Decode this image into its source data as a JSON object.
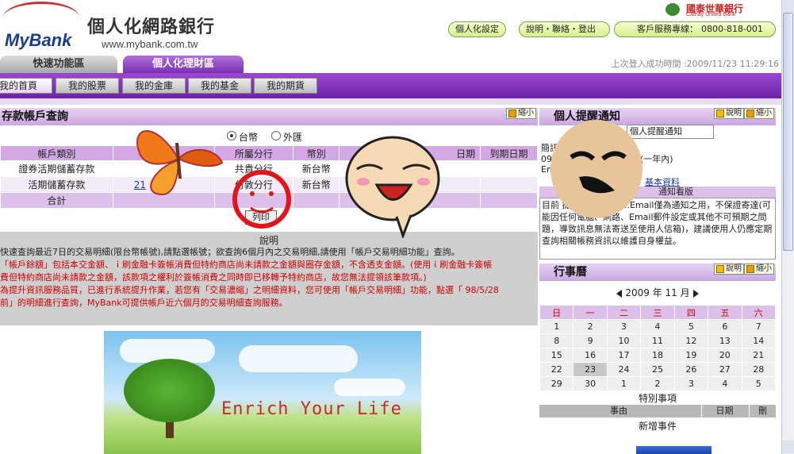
{
  "header": {
    "logo_text": "MyBank",
    "site_name": "個人化網路銀行",
    "site_url": "www.mybank.com.tw",
    "bank_name_cn": "國泰世華銀行",
    "bank_name_en": "Cathay United Bank",
    "btn_personal_settings": "個人化設定",
    "btn_help_links": "說明・聯絡・登出",
    "hotline_label": "客戶服務專線：",
    "hotline_number": "0800-818-001"
  },
  "tabs": {
    "quick": "快速功能區",
    "personal": "個人化理財區",
    "last_login": "上次登入成功時間 :2009/11/23 11:29:16"
  },
  "subtabs": [
    "我的首頁",
    "我的股票",
    "我的金庫",
    "我的基金",
    "我的期貨"
  ],
  "deposit": {
    "title": "存款帳戶查詢",
    "shrink": "縮小",
    "radio_twd": "台幣",
    "radio_fx": "外匯",
    "columns": [
      "帳戶類別",
      "",
      "所屬分行",
      "幣別",
      "日期",
      "到期日期"
    ],
    "rows": [
      [
        "證券活期儲蓄存款",
        "",
        "共貴分行",
        "新台幣",
        "9",
        ""
      ],
      [
        "活期儲蓄存款",
        "21",
        "付敦分行",
        "新台幣",
        "6",
        ""
      ]
    ],
    "total_label": "合計",
    "list_button": "列印",
    "notes_title": "說明",
    "notes": [
      "快速查詢最近7日的交易明細(限台幣帳號),請點選帳號；欲查詢6個月內之交易明細,請使用「帳戶交易明細功能」查詢。",
      "「帳戶餘額」包括本交金額、ｉ刷金融卡簽帳消費但特約商店尚未請款之金額與圈存金額，不含透支金額。(使用ｉ刷金融卡簽帳",
      "費但特約商店尚未請款之金額，該款項之權利於簽帳消費之同時即已移轉予特約商店，故您無法提領該筆款項。)",
      "為提升資訊服務品質，已進行系統提升作業，若您有「交易濃縮」之明細資料，您可使用「帳戶交易明細」功能，點選「 98/5/28",
      "前」的明細進行查詢，MyBank可提供帳戶近六個月的交易明細查詢服務。"
    ]
  },
  "banner": {
    "text": "Enrich Your Life"
  },
  "reminder": {
    "title": "個人提醒通知",
    "help": "說明",
    "shrink": "縮小",
    "popup": "個人提醒通知",
    "line1": "簡訊",
    "line2": "09",
    "line3": "Em                                                    ail.com",
    "tail2": "通(一年內)",
    "basic_link": "基本資料",
    "notice_bar": "通知看版",
    "notice_text": "目前                              提醒您...............Email僅為通知之用，不保證寄達(可能因任何電腦、網路、Email郵件設定或其他不可預期之問題，導致訊息無法寄送至使用人信箱)，建議使用人仍應定期查詢相關帳務資訊以維護自身權益。"
  },
  "calendar": {
    "title": "行事曆",
    "help": "說明",
    "shrink": "縮小",
    "month_label": "2009 年 11 月",
    "weekdays": [
      "日",
      "一",
      "二",
      "三",
      "四",
      "五",
      "六"
    ],
    "weeks": [
      [
        "1",
        "2",
        "3",
        "4",
        "5",
        "6",
        "7"
      ],
      [
        "8",
        "9",
        "10",
        "11",
        "12",
        "13",
        "14"
      ],
      [
        "15",
        "16",
        "17",
        "18",
        "19",
        "20",
        "21"
      ],
      [
        "22",
        "23",
        "24",
        "25",
        "26",
        "27",
        "28"
      ],
      [
        "29",
        "30",
        "1",
        "2",
        "3",
        "4",
        "5"
      ]
    ],
    "today": "23",
    "special_title": "特別事項",
    "events_cols": [
      "事由",
      "日期",
      "刪"
    ],
    "add_event": "新增事件"
  }
}
